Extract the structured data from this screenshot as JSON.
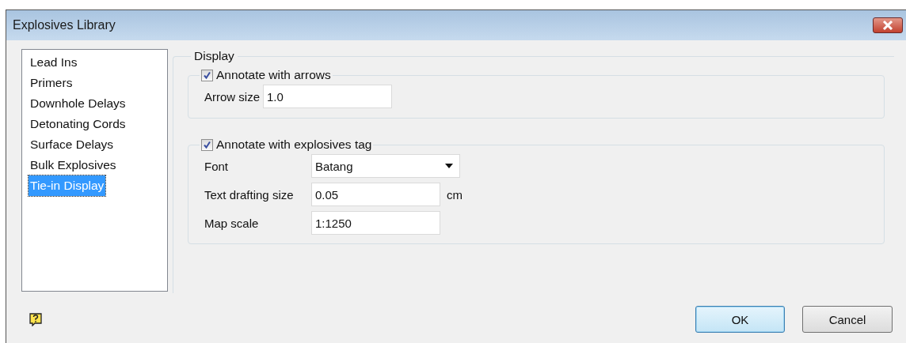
{
  "window": {
    "title": "Explosives Library"
  },
  "sidebar": {
    "items": [
      {
        "label": "Lead Ins",
        "selected": false
      },
      {
        "label": "Primers",
        "selected": false
      },
      {
        "label": "Downhole Delays",
        "selected": false
      },
      {
        "label": "Detonating Cords",
        "selected": false
      },
      {
        "label": "Surface Delays",
        "selected": false
      },
      {
        "label": "Bulk Explosives",
        "selected": false
      },
      {
        "label": "Tie-in Display",
        "selected": true
      }
    ]
  },
  "display": {
    "title": "Display",
    "arrows": {
      "label": "Annotate with arrows",
      "checked": true,
      "field": {
        "label": "Arrow size",
        "value": "1.0"
      }
    },
    "tag": {
      "label": "Annotate with explosives tag",
      "checked": true,
      "fields": [
        {
          "kind": "dropdown",
          "label": "Font",
          "value": "Batang"
        },
        {
          "kind": "text",
          "label": "Text drafting size",
          "value": "0.05",
          "unit": "cm"
        },
        {
          "kind": "text",
          "label": "Map scale",
          "value": "1:1250"
        }
      ]
    }
  },
  "buttons": [
    {
      "label": "OK",
      "default": true
    },
    {
      "label": "Cancel",
      "default": false
    }
  ]
}
